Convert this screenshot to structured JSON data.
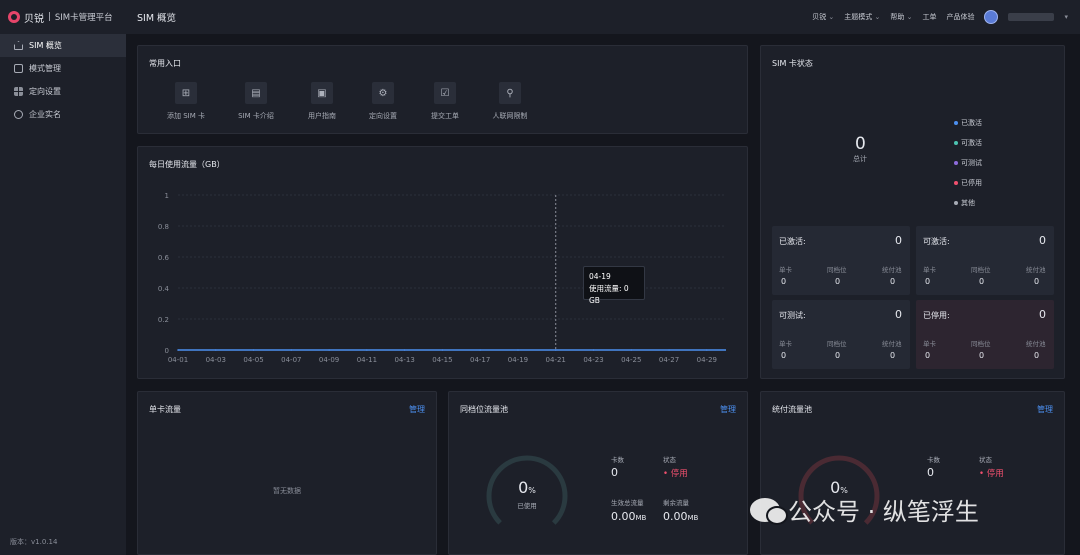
{
  "app": {
    "brand": "贝锐",
    "subtitle": "SIM卡管理平台",
    "page_title": "SIM 概览",
    "version": "版本：v1.0.14"
  },
  "header": {
    "menu": [
      "贝锐",
      "主题模式",
      "帮助",
      "工单",
      "产品体验"
    ]
  },
  "sidebar": {
    "items": [
      {
        "label": "SIM 概览",
        "icon": "home-icon",
        "active": true
      },
      {
        "label": "模式管理",
        "icon": "file-icon",
        "active": false
      },
      {
        "label": "定向设置",
        "icon": "grid-icon",
        "active": false
      },
      {
        "label": "企业实名",
        "icon": "user-circle-icon",
        "active": false
      }
    ]
  },
  "quick": {
    "title": "常用入口",
    "entries": [
      {
        "label": "添加 SIM 卡",
        "icon": "plus-square-icon",
        "glyph": "⊞"
      },
      {
        "label": "SIM 卡介绍",
        "icon": "document-icon",
        "glyph": "▤"
      },
      {
        "label": "用户指南",
        "icon": "book-icon",
        "glyph": "▣"
      },
      {
        "label": "定向设置",
        "icon": "settings-doc-icon",
        "glyph": "⚙"
      },
      {
        "label": "提交工单",
        "icon": "ticket-icon",
        "glyph": "☑"
      },
      {
        "label": "人联网限制",
        "icon": "person-limit-icon",
        "glyph": "⚲"
      }
    ]
  },
  "daily": {
    "title": "每日使用流量（GB）",
    "tooltip_date": "04-19",
    "tooltip_text": "使用流量: 0 GB"
  },
  "chart_data": {
    "type": "line",
    "title": "每日使用流量（GB）",
    "x": [
      "04-01",
      "04-03",
      "04-05",
      "04-07",
      "04-09",
      "04-11",
      "04-13",
      "04-15",
      "04-17",
      "04-19",
      "04-21",
      "04-23",
      "04-25",
      "04-27",
      "04-29"
    ],
    "y_ticks": [
      "0",
      "0.2",
      "0.4",
      "0.6",
      "0.8",
      "1"
    ],
    "series": [
      {
        "values": [
          0,
          0,
          0,
          0,
          0,
          0,
          0,
          0,
          0,
          0,
          0,
          0,
          0,
          0,
          0
        ]
      }
    ],
    "ylim": [
      0,
      1
    ],
    "color": "#4c8ff0",
    "grid": true,
    "highlight": "04-21"
  },
  "sim_status": {
    "title": "SIM 卡状态",
    "total": "0",
    "total_label": "总计",
    "legend": [
      {
        "label": "已激活",
        "color": "#4c8ff0"
      },
      {
        "label": "可激活",
        "color": "#4cc3b0"
      },
      {
        "label": "可测试",
        "color": "#8e6bdc"
      },
      {
        "label": "已停用",
        "color": "#f0506e"
      },
      {
        "label": "其他",
        "color": "#a7abb5"
      }
    ],
    "boxes": [
      {
        "name": "已激活:",
        "value": "0",
        "subs": [
          "单卡",
          "同档位",
          "统付池"
        ],
        "vals": [
          "0",
          "0",
          "0"
        ]
      },
      {
        "name": "可激活:",
        "value": "0",
        "subs": [
          "单卡",
          "同档位",
          "统付池"
        ],
        "vals": [
          "0",
          "0",
          "0"
        ]
      },
      {
        "name": "可测试:",
        "value": "0",
        "subs": [
          "单卡",
          "同档位",
          "统付池"
        ],
        "vals": [
          "0",
          "0",
          "0"
        ]
      },
      {
        "name": "已停用:",
        "value": "0",
        "subs": [
          "单卡",
          "同档位",
          "统付池"
        ],
        "vals": [
          "0",
          "0",
          "0"
        ]
      }
    ]
  },
  "single": {
    "title": "单卡流量",
    "manage": "管理",
    "empty": "暂无数据"
  },
  "same_pool": {
    "title": "同档位流量池",
    "manage": "管理",
    "percent": "0",
    "unit": "%",
    "used_label": "已使用",
    "card_label": "卡数",
    "card_value": "0",
    "state_label": "状态",
    "state_value": "• 停用",
    "total_label": "生效总流量",
    "total_value": "0.00",
    "remain_label": "剩余流量",
    "remain_value": "0.00",
    "mb": "MB",
    "usage": 0
  },
  "unified_pool": {
    "title": "统付流量池",
    "manage": "管理",
    "percent": "0",
    "unit": "%",
    "card_label": "卡数",
    "card_value": "0",
    "state_label": "状态",
    "state_value": "• 停用",
    "usage": 0
  },
  "watermark": {
    "text": "公众号 · 纵笔浮生"
  }
}
